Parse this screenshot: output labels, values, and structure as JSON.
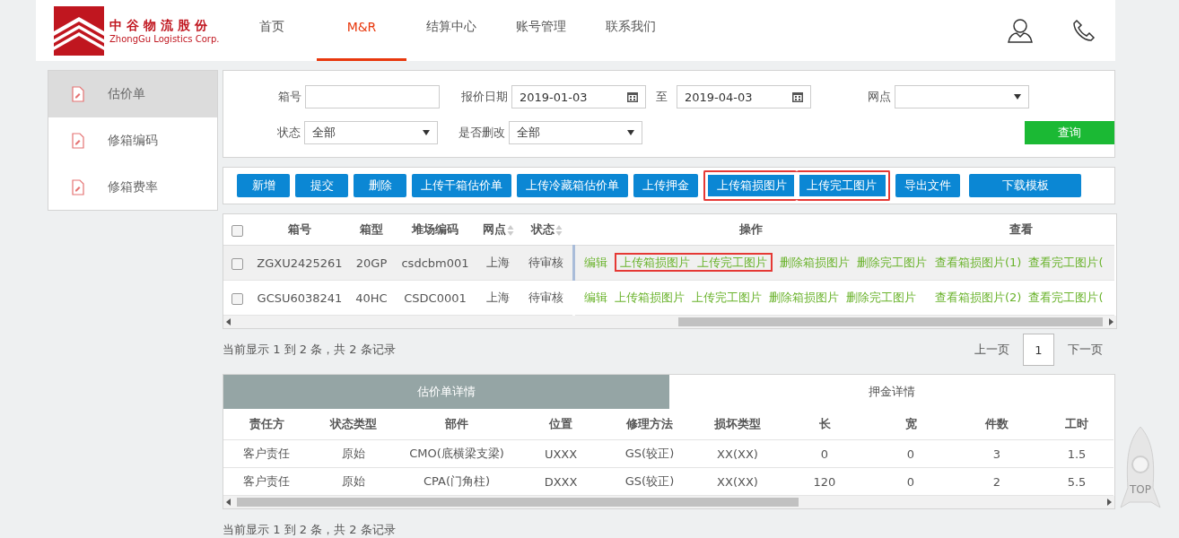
{
  "header": {
    "logo_cn": "中谷物流股份",
    "logo_en": "ZhongGu Logistics Corp.",
    "nav": [
      {
        "label": "首页",
        "selected": false
      },
      {
        "label": "M&R",
        "selected": true
      },
      {
        "label": "结算中心",
        "selected": false
      },
      {
        "label": "账号管理",
        "selected": false
      },
      {
        "label": "联系我们",
        "selected": false
      }
    ]
  },
  "sidebar": {
    "items": [
      {
        "label": "估价单",
        "selected": true
      },
      {
        "label": "修箱编码",
        "selected": false
      },
      {
        "label": "修箱费率",
        "selected": false
      }
    ]
  },
  "filters": {
    "box_no": {
      "label": "箱号"
    },
    "quote_date": {
      "label": "报价日期",
      "from": "2019-01-03",
      "to_label": "至",
      "to": "2019-04-03"
    },
    "branch": {
      "label": "网点"
    },
    "status": {
      "label": "状态",
      "value": "全部"
    },
    "modified": {
      "label": "是否删改",
      "value": "全部"
    },
    "search_button": "查询"
  },
  "toolbar": [
    {
      "label": "新增",
      "highlighted": false
    },
    {
      "label": "提交",
      "highlighted": false
    },
    {
      "label": "删除",
      "highlighted": false
    },
    {
      "label": "上传干箱估价单",
      "highlighted": false
    },
    {
      "label": "上传冷藏箱估价单",
      "highlighted": false
    },
    {
      "label": "上传押金",
      "highlighted": false
    },
    {
      "label": "上传箱损图片",
      "highlighted": true
    },
    {
      "label": "上传完工图片",
      "highlighted": true
    },
    {
      "label": "导出文件",
      "highlighted": false
    },
    {
      "label": "下载模板",
      "highlighted": false
    }
  ],
  "table": {
    "select_all_checked": false,
    "columns": [
      {
        "label": "箱号",
        "sortable": false
      },
      {
        "label": "箱型",
        "sortable": false
      },
      {
        "label": "堆场编码",
        "sortable": false
      },
      {
        "label": "网点",
        "sortable": true
      },
      {
        "label": "状态",
        "sortable": true
      },
      {
        "label": "操作",
        "sortable": false
      },
      {
        "label": "查看",
        "sortable": false
      }
    ],
    "rows": [
      {
        "selected": true,
        "checked": false,
        "cells": [
          "ZGXU2425261",
          "20GP",
          "csdcbm001",
          "上海",
          "待审核"
        ],
        "actions": [
          {
            "label": "编辑",
            "highlighted": false
          },
          {
            "label": "上传箱损图片",
            "highlighted": true
          },
          {
            "label": "上传完工图片",
            "highlighted": true
          },
          {
            "label": "删除箱损图片",
            "highlighted": false
          },
          {
            "label": "删除完工图片",
            "highlighted": false
          }
        ],
        "views": [
          "查看箱损图片(1)",
          "查看完工图片("
        ]
      },
      {
        "selected": false,
        "checked": false,
        "cells": [
          "GCSU6038241",
          "40HC",
          "CSDC0001",
          "上海",
          "待审核"
        ],
        "actions": [
          {
            "label": "编辑",
            "highlighted": false
          },
          {
            "label": "上传箱损图片",
            "highlighted": false
          },
          {
            "label": "上传完工图片",
            "highlighted": false
          },
          {
            "label": "删除箱损图片",
            "highlighted": false
          },
          {
            "label": "删除完工图片",
            "highlighted": false
          }
        ],
        "views": [
          "查看箱损图片(2)",
          "查看完工图片("
        ]
      }
    ]
  },
  "pagination": {
    "summary": "当前显示 1 到 2 条，共 2 条记录",
    "prev": "上一页",
    "pages": [
      {
        "label": "1",
        "selected": true
      }
    ],
    "next": "下一页"
  },
  "detail": {
    "tabs": [
      {
        "label": "估价单详情",
        "selected": true
      },
      {
        "label": "押金详情",
        "selected": false
      }
    ],
    "columns": [
      "责任方",
      "状态类型",
      "部件",
      "位置",
      "修理方法",
      "损坏类型",
      "长",
      "宽",
      "件数",
      "工时"
    ],
    "rows": [
      [
        "客户责任",
        "原始",
        "CMO(底横梁支梁)",
        "UXXX",
        "GS(较正)",
        "XX(XX)",
        "0",
        "0",
        "3",
        "1.5"
      ],
      [
        "客户责任",
        "原始",
        "CPA(门角柱)",
        "DXXX",
        "GS(较正)",
        "XX(XX)",
        "120",
        "0",
        "2",
        "5.5"
      ]
    ],
    "summary": "当前显示 1 到 2 条，共 2 条记录"
  },
  "back_to_top": "TOP"
}
